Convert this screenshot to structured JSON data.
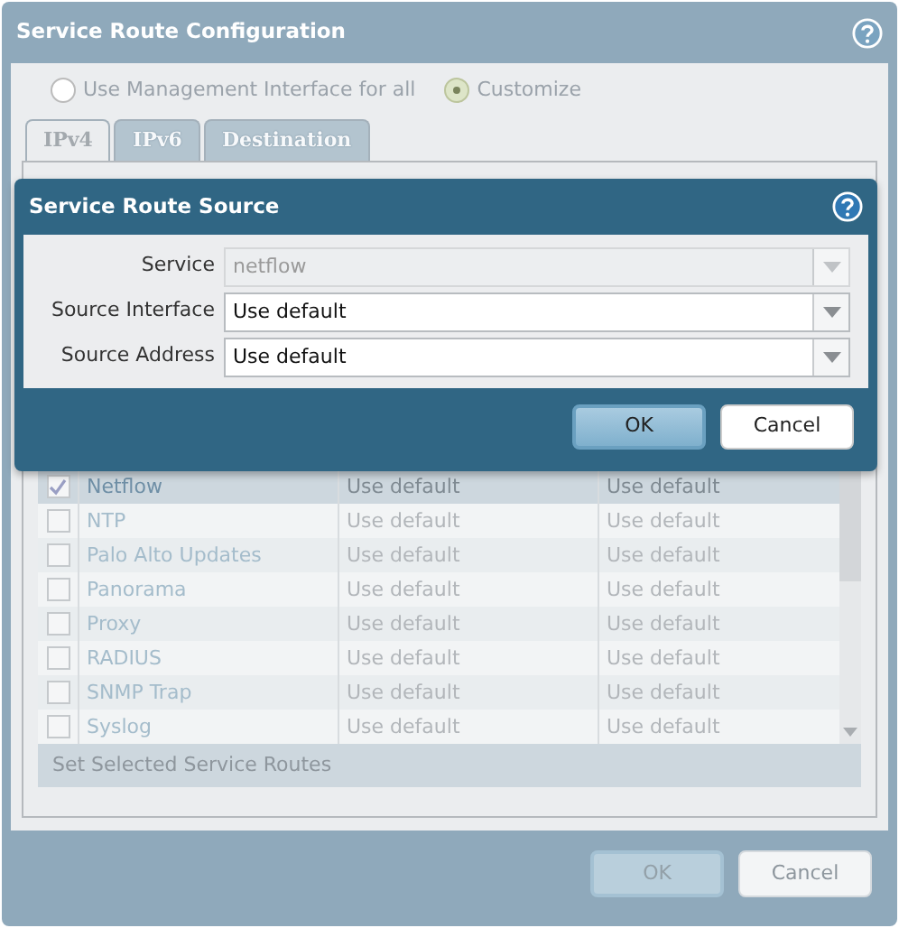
{
  "dialog": {
    "title": "Service Route Configuration",
    "route_options": [
      {
        "label": "Use Management Interface for all",
        "selected": false
      },
      {
        "label": "Customize",
        "selected": true
      }
    ],
    "tabs": [
      {
        "label": "IPv4",
        "selected": true
      },
      {
        "label": "IPv6",
        "selected": false
      },
      {
        "label": "Destination",
        "selected": false
      }
    ],
    "table": {
      "rows": [
        {
          "service": "Netflow",
          "column_2": "Use default",
          "column_3": "Use default",
          "checked": true,
          "selected": true
        },
        {
          "service": "NTP",
          "column_2": "Use default",
          "column_3": "Use default",
          "checked": false,
          "selected": false
        },
        {
          "service": "Palo Alto Updates",
          "column_2": "Use default",
          "column_3": "Use default",
          "checked": false,
          "selected": false
        },
        {
          "service": "Panorama",
          "column_2": "Use default",
          "column_3": "Use default",
          "checked": false,
          "selected": false
        },
        {
          "service": "Proxy",
          "column_2": "Use default",
          "column_3": "Use default",
          "checked": false,
          "selected": false
        },
        {
          "service": "RADIUS",
          "column_2": "Use default",
          "column_3": "Use default",
          "checked": false,
          "selected": false
        },
        {
          "service": "SNMP Trap",
          "column_2": "Use default",
          "column_3": "Use default",
          "checked": false,
          "selected": false
        },
        {
          "service": "Syslog",
          "column_2": "Use default",
          "column_3": "Use default",
          "checked": false,
          "selected": false
        }
      ]
    },
    "footer_action": "Set Selected Service Routes",
    "buttons": [
      {
        "label": "OK",
        "kind": "primary"
      },
      {
        "label": "Cancel",
        "kind": "secondary"
      }
    ]
  },
  "modal": {
    "title": "Service Route Source",
    "fields": [
      {
        "label": "Service",
        "value": "netflow",
        "disabled": true
      },
      {
        "label": "Source Interface",
        "value": "Use default",
        "disabled": false
      },
      {
        "label": "Source Address",
        "value": "Use default",
        "disabled": false
      }
    ],
    "buttons": [
      {
        "label": "OK",
        "kind": "primary"
      },
      {
        "label": "Cancel",
        "kind": "secondary"
      }
    ]
  }
}
